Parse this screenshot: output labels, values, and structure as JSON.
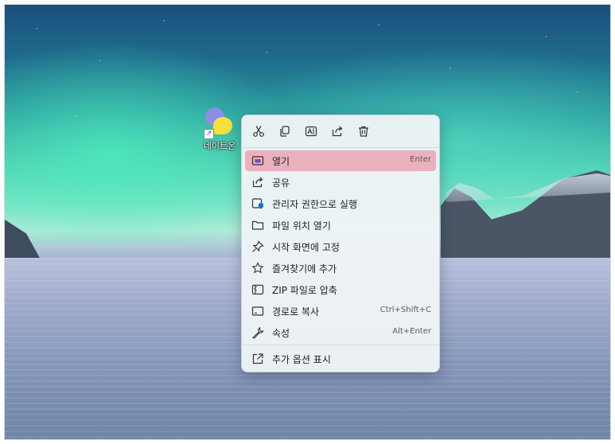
{
  "desktop": {
    "icon_label": "네이트온"
  },
  "context_menu": {
    "toolbar": [
      {
        "name": "cut-icon"
      },
      {
        "name": "copy-icon"
      },
      {
        "name": "rename-icon"
      },
      {
        "name": "share-icon"
      },
      {
        "name": "delete-icon"
      }
    ],
    "items": [
      {
        "label": "열기",
        "shortcut": "Enter",
        "icon": "open-icon",
        "highlighted": true
      },
      {
        "label": "공유",
        "shortcut": "",
        "icon": "share-icon"
      },
      {
        "label": "관리자 권한으로 실행",
        "shortcut": "",
        "icon": "shield-icon"
      },
      {
        "label": "파일 위치 열기",
        "shortcut": "",
        "icon": "folder-icon"
      },
      {
        "label": "시작 화면에 고정",
        "shortcut": "",
        "icon": "pin-icon"
      },
      {
        "label": "즐겨찾기에 추가",
        "shortcut": "",
        "icon": "star-icon"
      },
      {
        "label": "ZIP 파일로 압축",
        "shortcut": "",
        "icon": "zip-icon"
      },
      {
        "label": "경로로 복사",
        "shortcut": "Ctrl+Shift+C",
        "icon": "path-icon"
      },
      {
        "label": "속성",
        "shortcut": "Alt+Enter",
        "icon": "wrench-icon"
      },
      {
        "label": "추가 옵션 표시",
        "shortcut": "",
        "icon": "more-options-icon"
      }
    ]
  },
  "colors": {
    "highlight": "#eab0bd",
    "highlight_shadow": "#9aa6e6",
    "menu_bg": "#eef4f6",
    "accent": "#1a6fd1"
  }
}
